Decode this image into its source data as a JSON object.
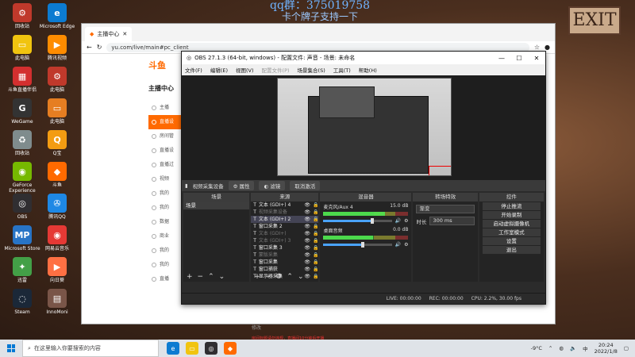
{
  "overlay": {
    "qq": "qq群：375019758",
    "slogan": "卡个牌子支持一下"
  },
  "exit_sign": "EXIT",
  "desktop_icons": [
    {
      "label": "回收站",
      "glyph": "⚙",
      "color": "#c0392b"
    },
    {
      "label": "Microsoft Edge",
      "glyph": "e",
      "color": "#0c7bd1"
    },
    {
      "label": "此电脑",
      "glyph": "▭",
      "color": "#f1c40f"
    },
    {
      "label": "腾讯视频",
      "glyph": "▶",
      "color": "#ff8c00"
    },
    {
      "label": "斗鱼直播伴侣",
      "glyph": "▦",
      "color": "#d32f2f"
    },
    {
      "label": "此电脑",
      "glyph": "⚙",
      "color": "#c0392b"
    },
    {
      "label": "WeGame",
      "glyph": "G",
      "color": "#333"
    },
    {
      "label": "此电脑",
      "glyph": "▭",
      "color": "#e67e22"
    },
    {
      "label": "回收站",
      "glyph": "♻",
      "color": "#7f8c8d"
    },
    {
      "label": "Q宝",
      "glyph": "Q",
      "color": "#f39c12"
    },
    {
      "label": "GeForce Experience",
      "glyph": "◉",
      "color": "#76b900"
    },
    {
      "label": "斗鱼",
      "glyph": "◆",
      "color": "#ff6a00"
    },
    {
      "label": "OBS",
      "glyph": "◎",
      "color": "#302e31"
    },
    {
      "label": "腾讯QQ",
      "glyph": "✇",
      "color": "#1e88e5"
    },
    {
      "label": "Microsoft Store",
      "glyph": "MP",
      "color": "#2874c6"
    },
    {
      "label": "网易云音乐",
      "glyph": "◉",
      "color": "#e53935"
    },
    {
      "label": "迅雷",
      "glyph": "✦",
      "color": "#43a047"
    },
    {
      "label": "向日葵",
      "glyph": "▶",
      "color": "#ff7043"
    },
    {
      "label": "Steam",
      "glyph": "◌",
      "color": "#1b2838"
    },
    {
      "label": "InnoMoni",
      "glyph": "▤",
      "color": "#795548"
    }
  ],
  "browser": {
    "tab_title": "主播中心",
    "url": "yu.com/live/main#pc_client",
    "address_label": "yu.com/live/main#pc_client",
    "logo": "斗鱼",
    "side_menu": {
      "header": "主播中心",
      "items": [
        "主播",
        "直播设",
        "房间管",
        "直播设",
        "直播过",
        "视频",
        "我的",
        "我的",
        "数据",
        "商业",
        "我的",
        "我的",
        "直播"
      ]
    },
    "footer_text": "修改",
    "notice": "房间标题请勿违规，直播间10分钟后开播"
  },
  "obs": {
    "title": "OBS 27.1.3 (64-bit, windows) - 配置文件: 声音 - 场景: 未命名",
    "menu": [
      "文件(F)",
      "编辑(E)",
      "视图(V)",
      "配置文件(P)",
      "场景集合(S)",
      "工具(T)",
      "帮助(H)"
    ],
    "toolbar": {
      "device": "视频采集设备",
      "props": "属性",
      "filters": "滤镜",
      "deactivate": "取消激活"
    },
    "docks": {
      "scenes_title": "场景",
      "scenes": [
        "场景"
      ],
      "sources_title": "来源",
      "sources": [
        {
          "name": "文本 (GDI+) 4",
          "dim": false,
          "sel": false
        },
        {
          "name": "视频采集设备",
          "dim": true,
          "sel": false
        },
        {
          "name": "文本 (GDI+) 2",
          "dim": false,
          "sel": true
        },
        {
          "name": "窗口采集 2",
          "dim": false,
          "sel": false
        },
        {
          "name": "文本 (GDI+)",
          "dim": true,
          "sel": false
        },
        {
          "name": "文本 (GDI+) 3",
          "dim": true,
          "sel": false
        },
        {
          "name": "窗口采集 3",
          "dim": false,
          "sel": false
        },
        {
          "name": "蒙版采集",
          "dim": true,
          "sel": false
        },
        {
          "name": "窗口采集",
          "dim": false,
          "sel": false
        },
        {
          "name": "窗口捕获",
          "dim": false,
          "sel": false
        },
        {
          "name": "显示器采集",
          "dim": false,
          "sel": false
        }
      ],
      "mixer_title": "混音器",
      "mixer": [
        {
          "name": "麦克风/Aux 4",
          "db": "15.0 dB",
          "level": 0.72
        },
        {
          "name": "桌面音频",
          "db": "0.0 dB",
          "level": 0.58
        }
      ],
      "trans_title": "转场特效",
      "trans_type": "渐变",
      "trans_dur_label": "时长",
      "trans_dur": "300 ms",
      "controls_title": "控件",
      "controls": [
        "停止推流",
        "开始录制",
        "启动虚拟摄像机",
        "工作室模式",
        "设置",
        "退出"
      ]
    },
    "status": {
      "live": "LIVE: 00:00:00",
      "rec": "REC: 00:00:00",
      "cpu": "CPU: 2.2%, 30.00 fps"
    }
  },
  "taskbar": {
    "search_placeholder": "在这里输入你要搜索的内容",
    "weather": "-9°C",
    "lang": "中",
    "time": "20:24",
    "date": "2022/1/8"
  }
}
